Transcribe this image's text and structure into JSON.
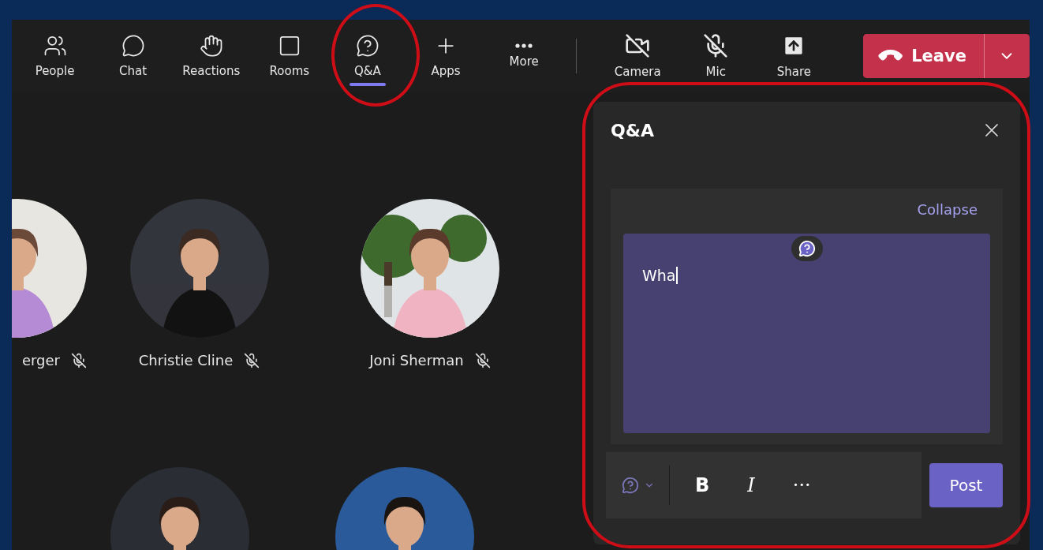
{
  "toolbar": {
    "items": [
      {
        "label": "People",
        "selected": false
      },
      {
        "label": "Chat",
        "selected": false
      },
      {
        "label": "Reactions",
        "selected": false
      },
      {
        "label": "Rooms",
        "selected": false
      },
      {
        "label": "Q&A",
        "selected": true
      },
      {
        "label": "Apps",
        "selected": false
      },
      {
        "label": "More",
        "selected": false
      }
    ],
    "devices": [
      {
        "label": "Camera",
        "on": false
      },
      {
        "label": "Mic",
        "on": false
      },
      {
        "label": "Share"
      }
    ],
    "leave": {
      "label": "Leave"
    }
  },
  "participants": [
    {
      "name": "erger",
      "muted": true
    },
    {
      "name": "Christie Cline",
      "muted": true
    },
    {
      "name": "Joni Sherman",
      "muted": true
    }
  ],
  "qa_panel": {
    "title": "Q&A",
    "collapse": "Collapse",
    "editor": {
      "value": "Wha"
    },
    "format_buttons": [
      "B",
      "I",
      "···"
    ],
    "post": "Post"
  }
}
